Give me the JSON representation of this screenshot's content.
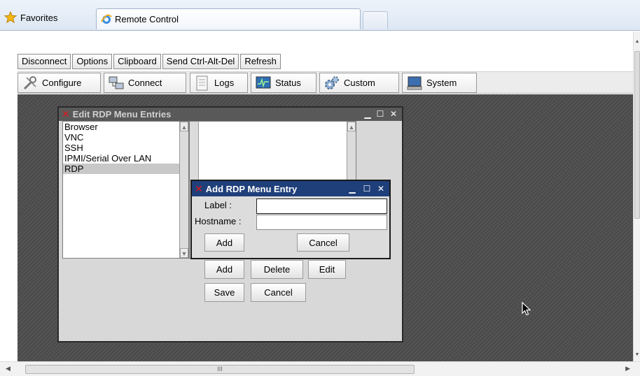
{
  "browser": {
    "favorites_label": "Favorites",
    "tab_title": "Remote Control"
  },
  "toolbar": {
    "row1": [
      "Disconnect",
      "Options",
      "Clipboard",
      "Send Ctrl-Alt-Del",
      "Refresh"
    ],
    "row2": [
      {
        "label": "Configure",
        "icon": "wrench-icon"
      },
      {
        "label": "Connect",
        "icon": "network-icon"
      },
      {
        "label": "Logs",
        "icon": "document-icon"
      },
      {
        "label": "Status",
        "icon": "monitor-graph-icon"
      },
      {
        "label": "Custom",
        "icon": "gears-icon"
      },
      {
        "label": "System",
        "icon": "computer-icon"
      }
    ]
  },
  "edit_window": {
    "title": "Edit RDP Menu Entries",
    "entries": [
      "Browser",
      "VNC",
      "SSH",
      "IPMI/Serial Over LAN",
      "RDP"
    ],
    "selected_index": 4,
    "buttons": {
      "add": "Add",
      "delete": "Delete",
      "edit": "Edit",
      "save": "Save",
      "cancel": "Cancel"
    }
  },
  "add_window": {
    "title": "Add RDP Menu Entry",
    "label_field": "Label :",
    "label_value": "",
    "hostname_field": "Hostname :",
    "hostname_value": "",
    "buttons": {
      "add": "Add",
      "cancel": "Cancel"
    }
  },
  "scrollbar": {
    "thumb_grip": "III"
  },
  "colors": {
    "title_active": "#1f3f7a",
    "title_inactive": "#595959",
    "close_x_logo": "#e01818",
    "desktop": "#4f4f4f"
  }
}
